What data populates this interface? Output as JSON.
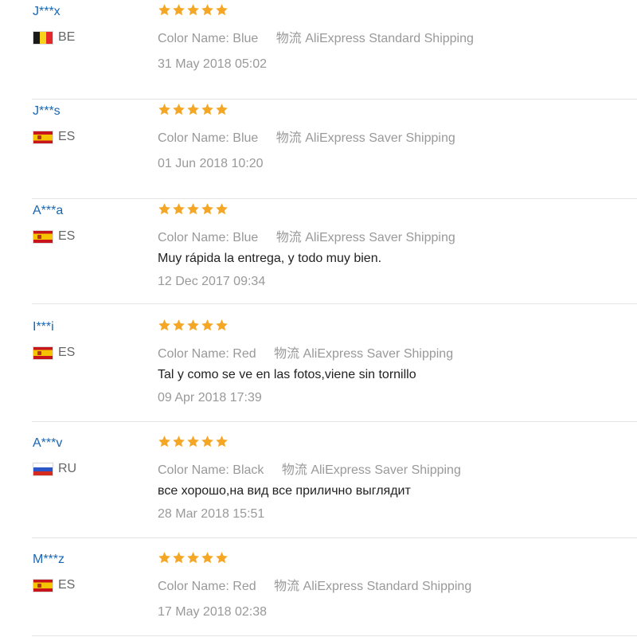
{
  "colors": {
    "username": "#1a66b3",
    "star": "#f5a623",
    "muted": "#999999",
    "text": "#222222",
    "divider": "#e4e4e4"
  },
  "reviews": [
    {
      "user": "J***x",
      "country_code": "BE",
      "flag_icon": "flag-be-icon",
      "rating": 5,
      "color_label": "Color Name:",
      "color_value": "Blue",
      "logistics_label": "物流",
      "shipping": "AliExpress Standard Shipping",
      "text": "",
      "date": "31 May 2018 05:02"
    },
    {
      "user": "J***s",
      "country_code": "ES",
      "flag_icon": "flag-es-icon",
      "rating": 5,
      "color_label": "Color Name:",
      "color_value": "Blue",
      "logistics_label": "物流",
      "shipping": "AliExpress Saver Shipping",
      "text": "",
      "date": "01 Jun 2018 10:20"
    },
    {
      "user": "A***a",
      "country_code": "ES",
      "flag_icon": "flag-es-icon",
      "rating": 5,
      "color_label": "Color Name:",
      "color_value": "Blue",
      "logistics_label": "物流",
      "shipping": "AliExpress Saver Shipping",
      "text": "Muy rápida la entrega, y todo muy bien.",
      "date": "12 Dec 2017 09:34"
    },
    {
      "user": "I***i",
      "country_code": "ES",
      "flag_icon": "flag-es-icon",
      "rating": 5,
      "color_label": "Color Name:",
      "color_value": "Red",
      "logistics_label": "物流",
      "shipping": "AliExpress Saver Shipping",
      "text": "Tal y como se ve en las fotos,viene sin tornillo",
      "date": "09 Apr 2018 17:39"
    },
    {
      "user": "A***v",
      "country_code": "RU",
      "flag_icon": "flag-ru-icon",
      "rating": 5,
      "color_label": "Color Name:",
      "color_value": "Black",
      "logistics_label": "物流",
      "shipping": "AliExpress Saver Shipping",
      "text": "все хорошо,на вид все прилично выглядит",
      "date": "28 Mar 2018 15:51"
    },
    {
      "user": "M***z",
      "country_code": "ES",
      "flag_icon": "flag-es-icon",
      "rating": 5,
      "color_label": "Color Name:",
      "color_value": "Red",
      "logistics_label": "物流",
      "shipping": "AliExpress Standard Shipping",
      "text": "",
      "date": "17 May 2018 02:38"
    }
  ]
}
